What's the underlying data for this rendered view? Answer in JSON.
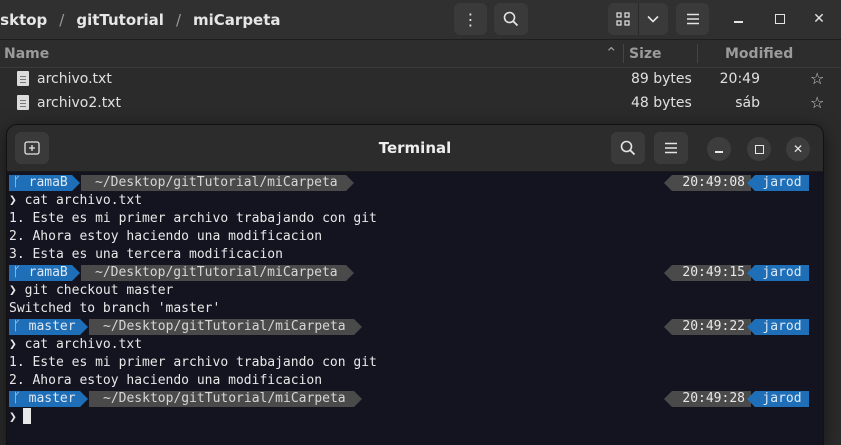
{
  "file_manager": {
    "breadcrumb": [
      "esktop",
      "gitTutorial",
      "miCarpeta"
    ],
    "columns": {
      "name": "Name",
      "size": "Size",
      "modified": "Modified"
    },
    "files": [
      {
        "name": "archivo.txt",
        "size": "89 bytes",
        "modified": "20:49"
      },
      {
        "name": "archivo2.txt",
        "size": "48 bytes",
        "modified": "sáb"
      }
    ]
  },
  "terminal": {
    "title": "Terminal",
    "prompt_char": "❯",
    "prompts": [
      {
        "branch": "ᚴ ramaB",
        "path": "~/Desktop/gitTutorial/miCarpeta",
        "time": "20:49:08",
        "user": "jarod"
      },
      {
        "branch": "ᚴ ramaB",
        "path": "~/Desktop/gitTutorial/miCarpeta",
        "time": "20:49:15",
        "user": "jarod"
      },
      {
        "branch": "ᚴ master",
        "path": "~/Desktop/gitTutorial/miCarpeta",
        "time": "20:49:22",
        "user": "jarod"
      },
      {
        "branch": "ᚴ master",
        "path": "~/Desktop/gitTutorial/miCarpeta",
        "time": "20:49:28",
        "user": "jarod"
      }
    ],
    "commands": [
      "cat archivo.txt",
      "git checkout master",
      "cat archivo.txt",
      ""
    ],
    "outputs": [
      [
        "1. Este es mi primer archivo trabajando con git",
        "2. Ahora estoy haciendo una modificacion",
        "3. Esta es una tercera modificacion"
      ],
      [
        "Switched to branch 'master'"
      ],
      [
        "1. Este es mi primer archivo trabajando con git",
        "2. Ahora estoy haciendo una modificacion"
      ]
    ]
  },
  "colors": {
    "accent_blue": "#1e6fb7",
    "segment_gray": "#4a4a4a",
    "terminal_bg": "#141421"
  },
  "icons": [
    "menu-dots-icon",
    "search-icon",
    "grid-view-icon",
    "chevron-down-icon",
    "hamburger-icon",
    "minimize-icon",
    "maximize-icon",
    "close-icon",
    "text-file-icon",
    "star-icon",
    "new-tab-icon"
  ]
}
